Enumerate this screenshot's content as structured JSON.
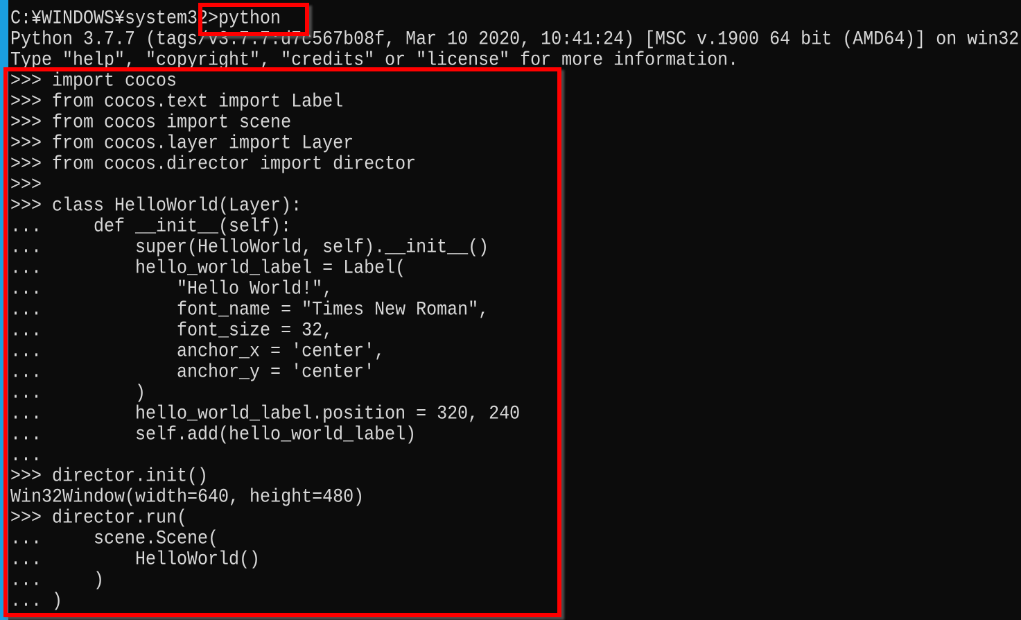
{
  "console": {
    "lines": [
      "C:¥WINDOWS¥system32>python",
      "Python 3.7.7 (tags/v3.7.7:d7c567b08f, Mar 10 2020, 10:41:24) [MSC v.1900 64 bit (AMD64)] on win32",
      "Type \"help\", \"copyright\", \"credits\" or \"license\" for more information.",
      ">>> import cocos",
      ">>> from cocos.text import Label",
      ">>> from cocos import scene",
      ">>> from cocos.layer import Layer",
      ">>> from cocos.director import director",
      ">>>",
      ">>> class HelloWorld(Layer):",
      "...     def __init__(self):",
      "...         super(HelloWorld, self).__init__()",
      "...         hello_world_label = Label(",
      "...             \"Hello World!\",",
      "...             font_name = \"Times New Roman\",",
      "...             font_size = 32,",
      "...             anchor_x = 'center',",
      "...             anchor_y = 'center'",
      "...         )",
      "...         hello_world_label.position = 320, 240",
      "...         self.add(hello_world_label)",
      "...",
      ">>> director.init()",
      "Win32Window(width=640, height=480)",
      ">>> director.run(",
      "...     scene.Scene(",
      "...         HelloWorld()",
      "...     )",
      "... )"
    ]
  },
  "highlight_color": "#ff0000"
}
